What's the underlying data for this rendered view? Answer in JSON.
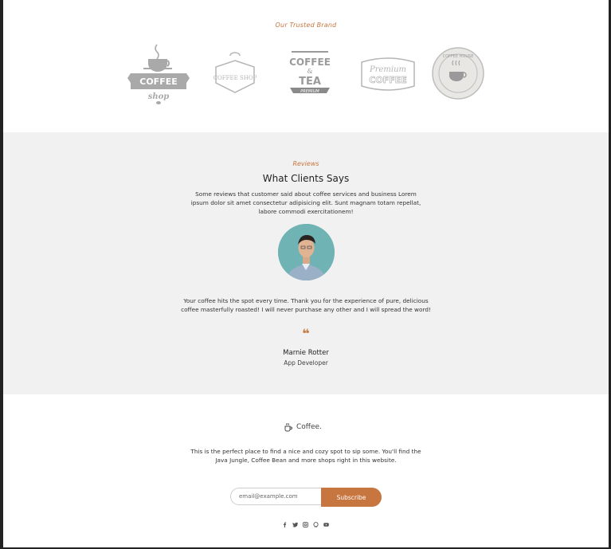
{
  "brands": {
    "title": "Our Trusted Brand",
    "logos": [
      {
        "name": "coffee-shop-logo",
        "text_top": "COFFEE",
        "text_bottom": "shop"
      },
      {
        "name": "coffee-shop-badge-logo",
        "text": "COFFEE SHOP"
      },
      {
        "name": "coffee-tea-logo",
        "text_top": "COFFEE",
        "text_mid": "&",
        "text_bottom": "TEA",
        "ribbon": "PREMIUM"
      },
      {
        "name": "premium-coffee-logo",
        "text_top": "Premium",
        "text_bottom": "COFFEE"
      },
      {
        "name": "coffee-house-seal-logo",
        "text": "COFFEE HOUSE"
      }
    ],
    "logo_color": "#a9a9a9"
  },
  "reviews": {
    "kicker": "Reviews",
    "title": "What Clients Says",
    "intro": "Some reviews that customer said about coffee services and business Lorem ipsum dolor sit amet consectetur adipisicing elit. Sunt magnam totam repellat, labore commodi exercitationem!",
    "testimonial": "Your coffee hits the spot every time. Thank you for the experience of pure, delicious coffee masterfully roasted! I will never purchase any other and I will spread the word!",
    "quote_mark": "❝",
    "reviewer_name": "Marnie Rotter",
    "reviewer_role": "App Developer"
  },
  "footer": {
    "brand_name": "Coffee.",
    "description": "This is the perfect place to find a nice and cozy spot to sip some. You'll find the Java Jungle, Coffee Bean and more shops right in this website.",
    "email_placeholder": "email@example.com",
    "subscribe_label": "Subscribe",
    "socials": [
      "facebook-icon",
      "twitter-icon",
      "instagram-icon",
      "github-icon",
      "youtube-icon"
    ]
  },
  "colors": {
    "accent": "#c8763f",
    "section_bg": "#f1f1f1",
    "text": "#333333"
  }
}
